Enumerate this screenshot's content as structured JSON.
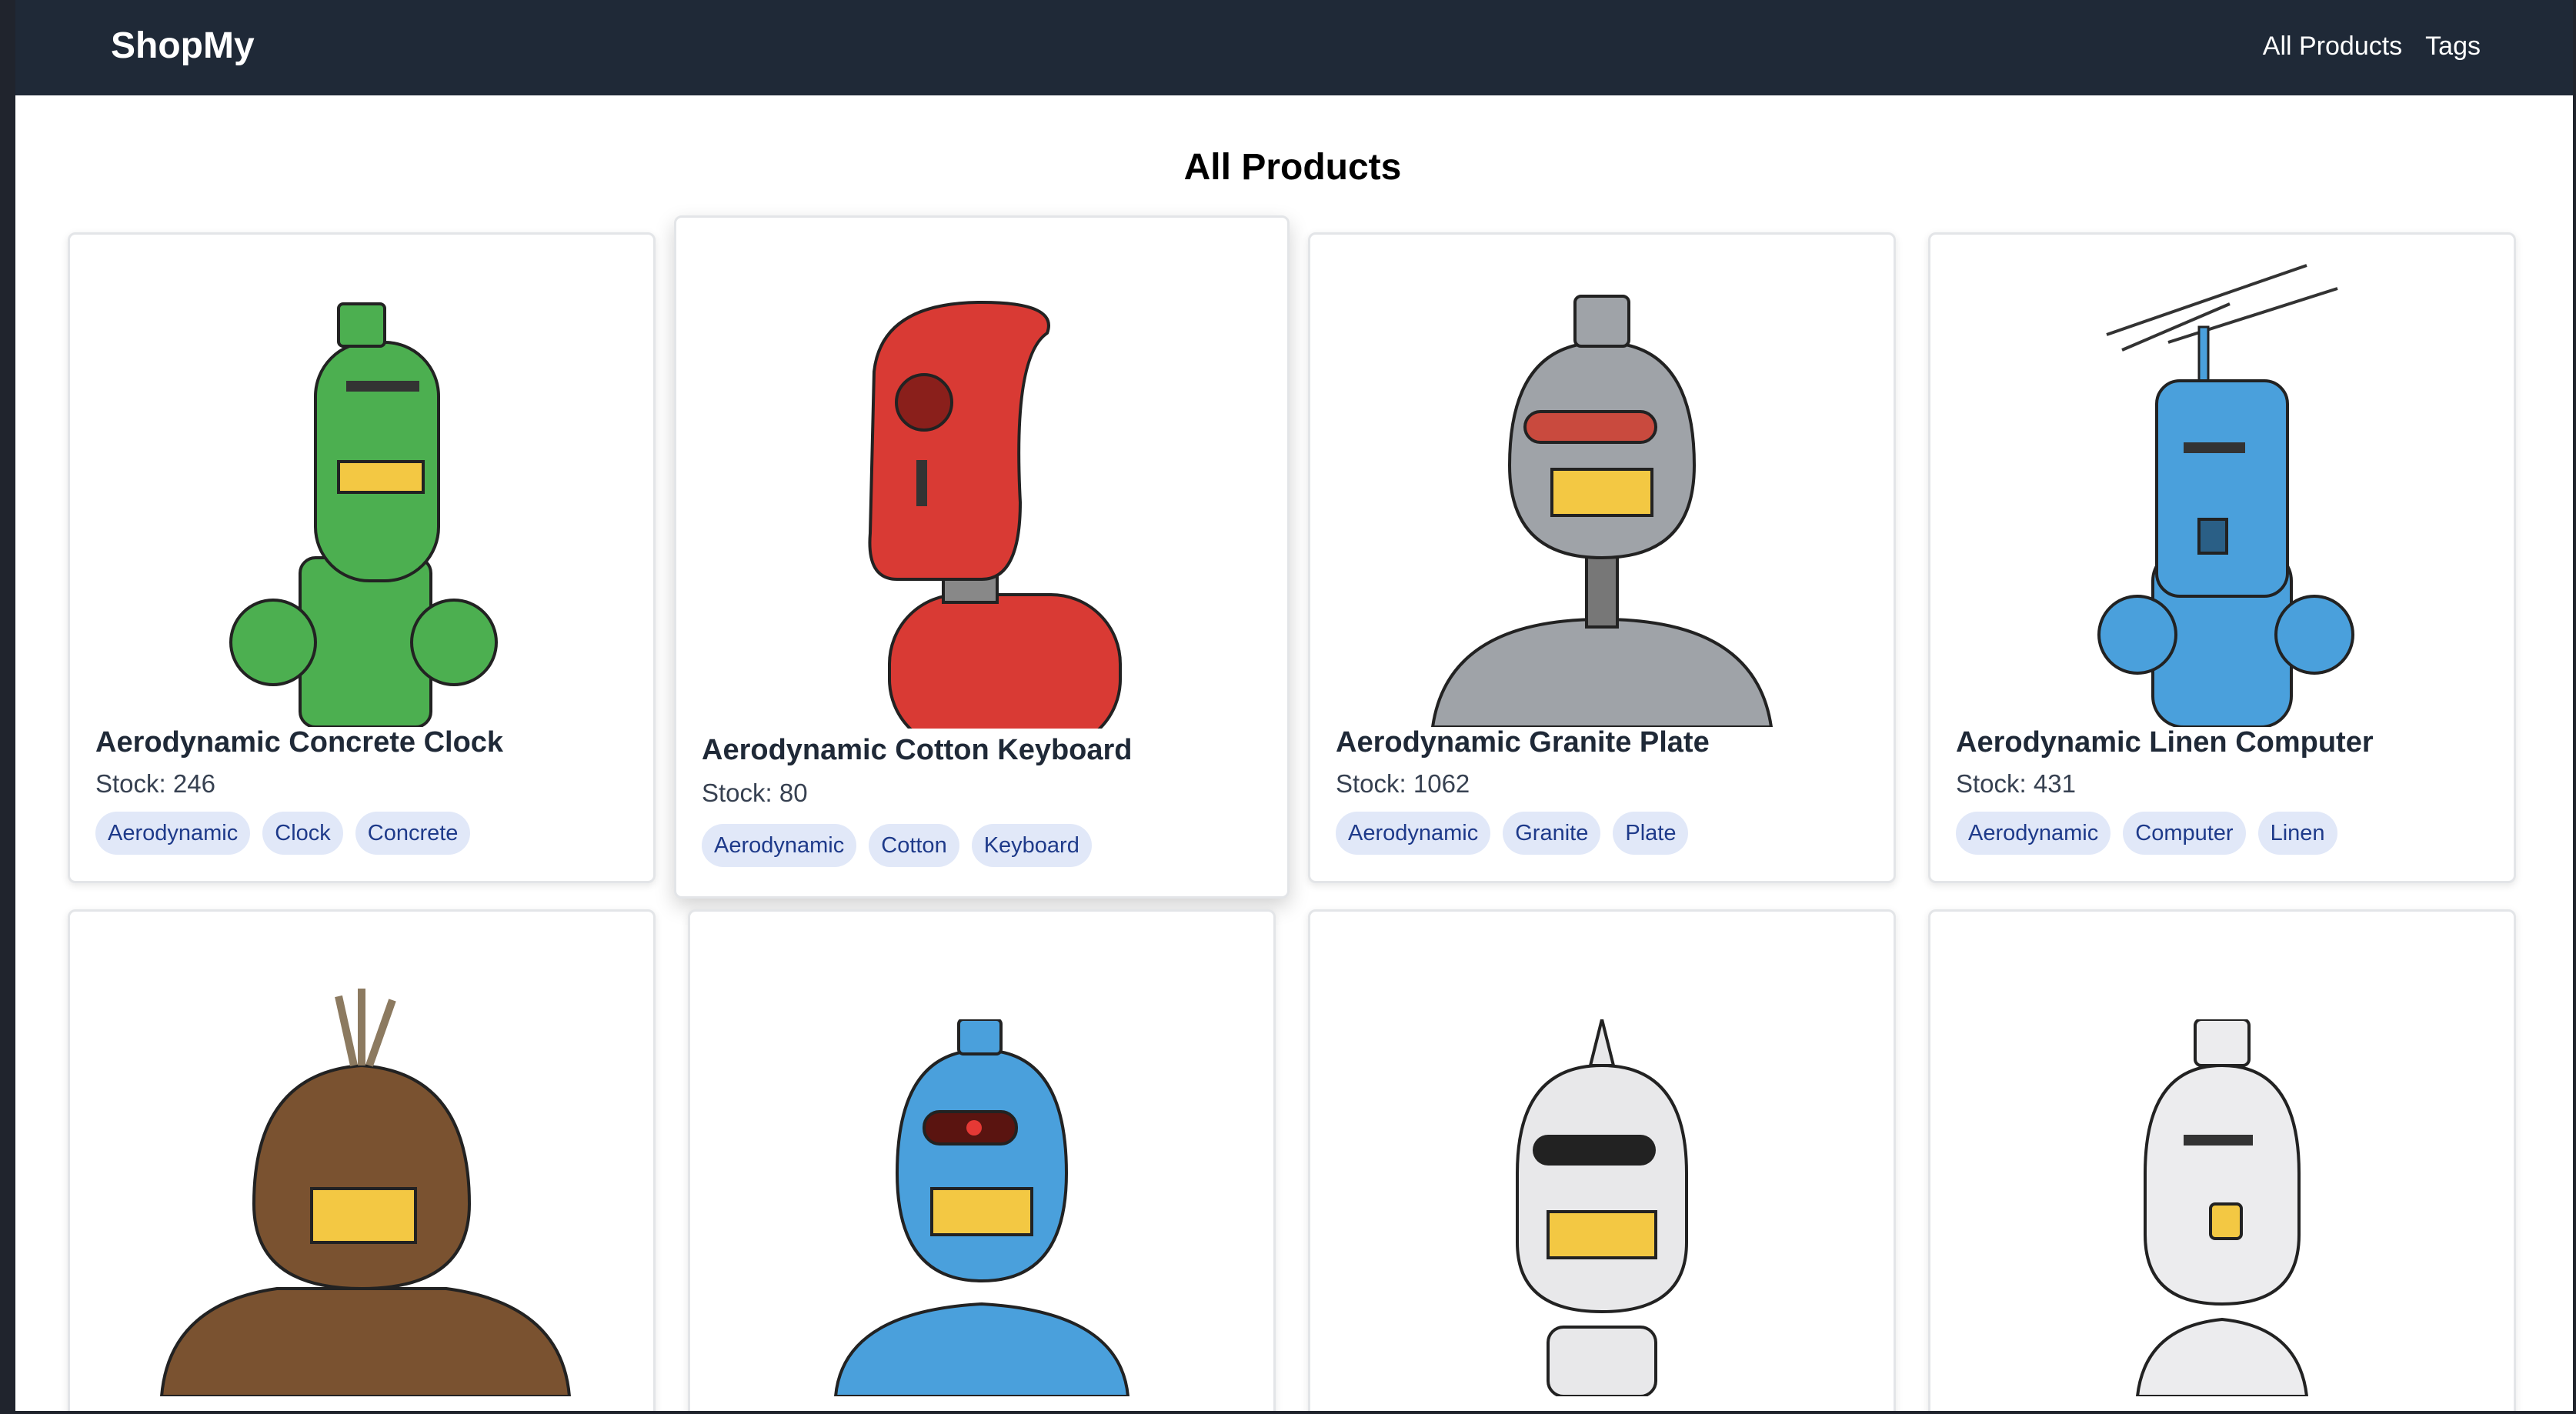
{
  "app": {
    "brand": "ShopMy"
  },
  "nav": {
    "all_products": "All Products",
    "tags": "Tags"
  },
  "page": {
    "title": "All Products"
  },
  "products": [
    {
      "name": "Aerodynamic Concrete Clock",
      "stock": "Stock: 246",
      "tags": [
        "Aerodynamic",
        "Clock",
        "Concrete"
      ],
      "robot_color": "#4caf50"
    },
    {
      "name": "Aerodynamic Cotton Keyboard",
      "stock": "Stock: 80",
      "tags": [
        "Aerodynamic",
        "Cotton",
        "Keyboard"
      ],
      "robot_color": "#d93a34"
    },
    {
      "name": "Aerodynamic Granite Plate",
      "stock": "Stock: 1062",
      "tags": [
        "Aerodynamic",
        "Granite",
        "Plate"
      ],
      "robot_color": "#9fa3a8"
    },
    {
      "name": "Aerodynamic Linen Computer",
      "stock": "Stock: 431",
      "tags": [
        "Aerodynamic",
        "Computer",
        "Linen"
      ],
      "robot_color": "#4aa0dc"
    },
    {
      "robot_color": "#7a5230"
    },
    {
      "robot_color": "#4aa0dc"
    },
    {
      "robot_color": "#e8e8ea"
    },
    {
      "robot_color": "#ececee"
    }
  ]
}
